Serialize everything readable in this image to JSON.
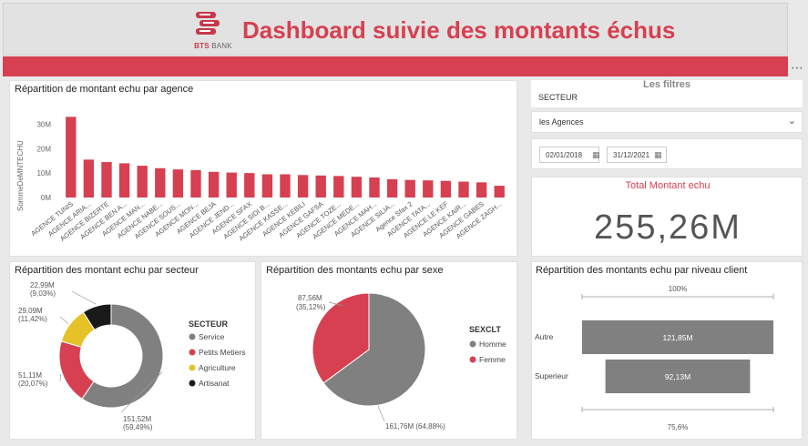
{
  "header": {
    "title": "Dashboard suivie des montants échus",
    "logo_bts": "BTS",
    "logo_bank": "BANK"
  },
  "filters": {
    "title": "Les filtres",
    "secteur_label": "SECTEUR",
    "agences_label": "les Agences",
    "date_from": "02/01/2018",
    "date_to": "31/12/2021"
  },
  "kpi": {
    "title": "Total Montant echu",
    "value": "255,26M"
  },
  "colors": {
    "accent": "#d64050",
    "grey": "#808080",
    "yellow": "#e5c228",
    "black": "#1a1a1a"
  },
  "chart_data": [
    {
      "type": "bar",
      "title": "Répartition de montant echu par agence",
      "ylabel": "SommeDeMNTECHU",
      "yticks": [
        "0M",
        "10M",
        "20M",
        "30M"
      ],
      "ylim": [
        0,
        35
      ],
      "categories": [
        "AGENCE TUNIS",
        "AGENCE ARIA...",
        "AGENCE BIZERTE",
        "AGENCE BEN A...",
        "AGENCE MAN...",
        "AGENCE NABE...",
        "AGENCE SOUS...",
        "AGENCE MON...",
        "AGENCE BEJA",
        "AGENCE JEND...",
        "AGENCE SFAX",
        "AGENCE SIDI B...",
        "AGENCE KASSE...",
        "AGENCE KEBILI",
        "AGENCE GAFSA",
        "AGENCE TOZE...",
        "AGENCE MEDE...",
        "AGENCE MAH...",
        "AGENCE SILIA...",
        "Agence Sfax 2",
        "AGENCE TATA...",
        "AGENCE LE KEF",
        "AGENCE KAIR...",
        "AGENCE GABES",
        "AGENCE ZAGH..."
      ],
      "values": [
        33,
        15.5,
        14.5,
        14,
        13,
        12,
        11.5,
        11.2,
        10.5,
        10.2,
        10,
        9.5,
        9.5,
        9.2,
        9,
        8.8,
        8.5,
        8.2,
        7.5,
        7.2,
        7,
        6.8,
        6.5,
        6.2,
        4.8
      ]
    },
    {
      "type": "pie",
      "title": "Répartition des montant echu par secteur",
      "legend_title": "SECTEUR",
      "series": [
        {
          "name": "Service",
          "value": 151.52,
          "label": "151,52M",
          "pct": "(59,49%)"
        },
        {
          "name": "Petits Metiers",
          "value": 51.11,
          "label": "51,11M",
          "pct": "(20,07%)"
        },
        {
          "name": "Agriculture",
          "value": 29.09,
          "label": "29,09M",
          "pct": "(11,42%)"
        },
        {
          "name": "Artisanat",
          "value": 22.99,
          "label": "22,99M",
          "pct": "(9,03%)"
        }
      ]
    },
    {
      "type": "pie",
      "title": "Répartition des montants echu par sexe",
      "legend_title": "SEXCLT",
      "series": [
        {
          "name": "Homme",
          "value": 161.76,
          "label": "161,76M",
          "pct": "(64,88%)"
        },
        {
          "name": "Femme",
          "value": 87.56,
          "label": "87,56M",
          "pct": "(35,12%)"
        }
      ]
    },
    {
      "type": "bar",
      "title": "Répartition des montants echu par niveau client",
      "top_pct": "100%",
      "bottom_pct": "75,6%",
      "categories": [
        "Autre",
        "Superieur"
      ],
      "values": [
        121.85,
        92.13
      ],
      "labels": [
        "121,85M",
        "92,13M"
      ]
    }
  ]
}
